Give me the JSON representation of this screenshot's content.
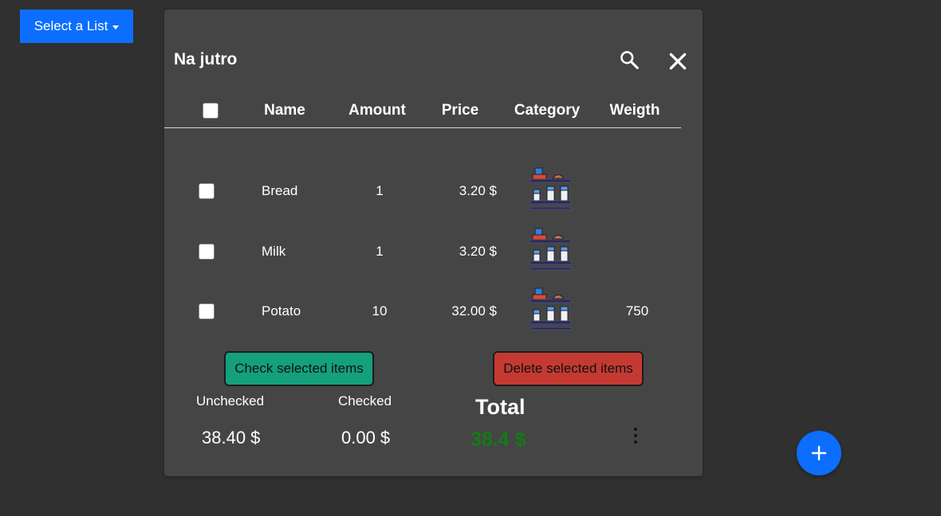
{
  "select_list": {
    "label": "Select a List"
  },
  "list": {
    "title": "Na jutro",
    "columns": [
      "Name",
      "Amount",
      "Price",
      "Category",
      "Weigth"
    ],
    "items": [
      {
        "name": "Bread",
        "amount": "1",
        "price": "3.20 $",
        "category_icon": "grocery-shelf-icon",
        "weight": ""
      },
      {
        "name": "Milk",
        "amount": "1",
        "price": "3.20 $",
        "category_icon": "grocery-shelf-icon",
        "weight": ""
      },
      {
        "name": "Potato",
        "amount": "10",
        "price": "32.00 $",
        "category_icon": "grocery-shelf-icon",
        "weight": "750"
      }
    ]
  },
  "actions": {
    "check_label": "Check selected items",
    "delete_label": "Delete selected items"
  },
  "summary": {
    "unchecked_label": "Unchecked",
    "unchecked_value": "38.40 $",
    "checked_label": "Checked",
    "checked_value": "0.00 $",
    "total_label": "Total",
    "total_value": "38.4 $"
  },
  "colors": {
    "primary": "#0d6efd",
    "check_button": "#14a07c",
    "delete_button": "#c43a33",
    "total_value": "#157a15"
  }
}
